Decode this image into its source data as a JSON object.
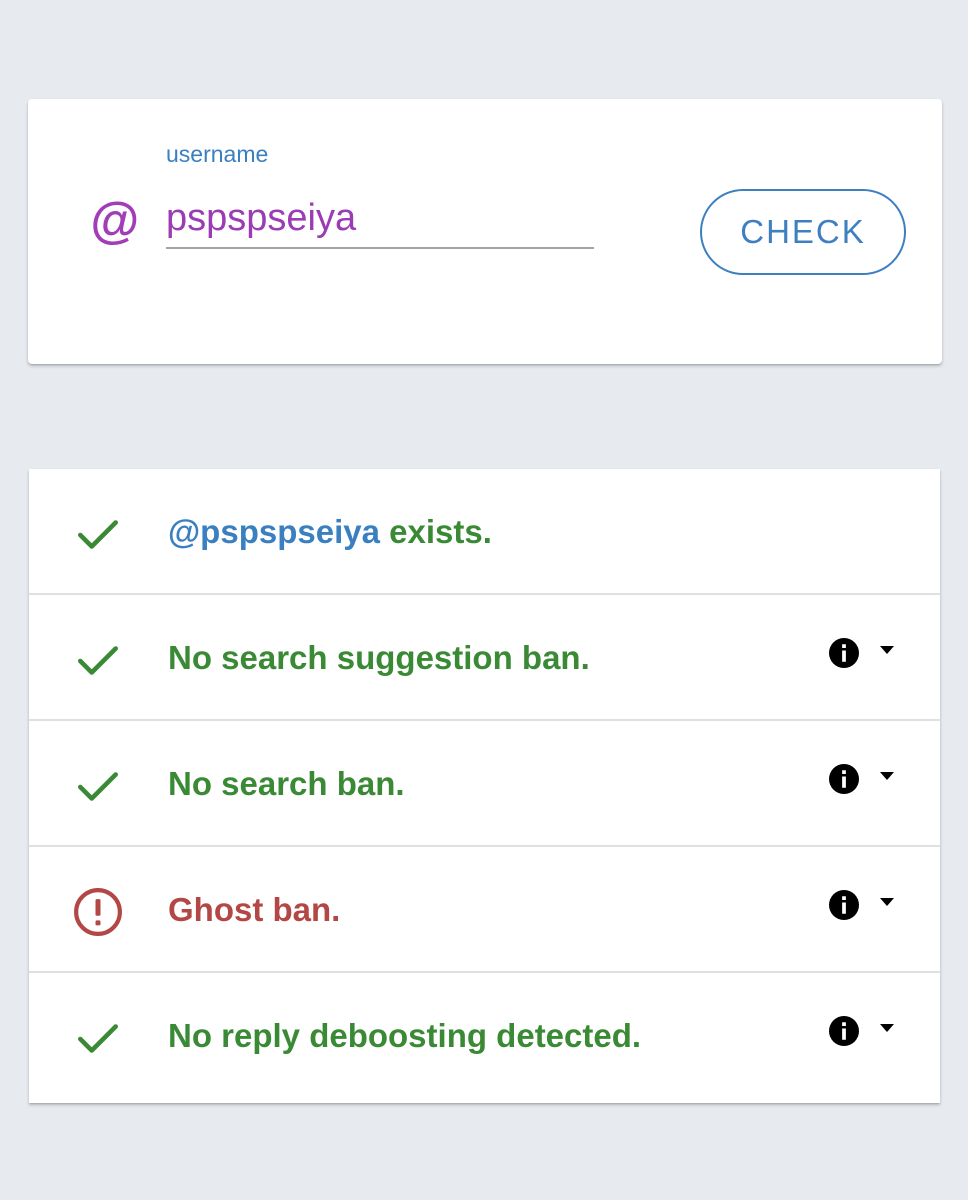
{
  "search": {
    "at_symbol": "@",
    "label": "username",
    "value": "pspspseiya",
    "button_label": "CHECK"
  },
  "results": [
    {
      "status": "ok",
      "handle": "@pspspseiya",
      "text": " exists.",
      "has_info": false
    },
    {
      "status": "ok",
      "handle": "",
      "text": "No search suggestion ban.",
      "has_info": true
    },
    {
      "status": "ok",
      "handle": "",
      "text": "No search ban.",
      "has_info": true
    },
    {
      "status": "warning",
      "handle": "",
      "text": "Ghost ban.",
      "has_info": true
    },
    {
      "status": "ok",
      "handle": "",
      "text": "No reply deboosting detected.",
      "has_info": true
    }
  ],
  "icons": {
    "ok": "check-icon",
    "warning": "alert-circle-icon",
    "info": "info-icon",
    "expand": "caret-down-icon"
  },
  "colors": {
    "background": "#e7ebef",
    "accent_purple": "#9b3cb4",
    "accent_blue": "#3d7fbf",
    "ok_green": "#3a8a35",
    "warning_red": "#b34745"
  }
}
